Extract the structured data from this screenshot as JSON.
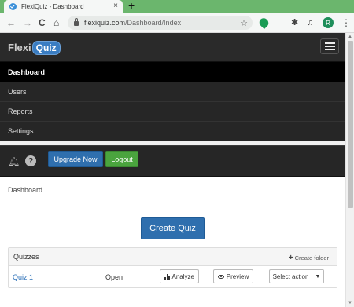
{
  "browser": {
    "tab_title": "FlexiQuiz - Dashboard",
    "tab_close": "×",
    "new_tab": "+",
    "url_domain": "flexiquiz.com",
    "url_path": "/Dashboard/Index",
    "nav_back": "←",
    "nav_forward": "→",
    "nav_reload": "C",
    "nav_home": "⌂",
    "star": "☆",
    "profile_initial": "R",
    "menu_dots": "⋮"
  },
  "app": {
    "logo_flexi": "Flexi",
    "logo_quiz": "Quiz",
    "menu": [
      {
        "label": "Dashboard",
        "active": true
      },
      {
        "label": "Users",
        "active": false
      },
      {
        "label": "Reports",
        "active": false
      },
      {
        "label": "Settings",
        "active": false
      }
    ],
    "help_glyph": "?",
    "upgrade_label": "Upgrade Now",
    "logout_label": "Logout"
  },
  "content": {
    "breadcrumb": "Dashboard",
    "create_quiz_label": "Create Quiz",
    "panel_title": "Quizzes",
    "create_folder_label": "Create folder",
    "quizzes": [
      {
        "name": "Quiz 1",
        "status": "Open",
        "analyze_label": "Analyze",
        "preview_label": "Preview",
        "select_action_label": "Select action"
      }
    ]
  }
}
